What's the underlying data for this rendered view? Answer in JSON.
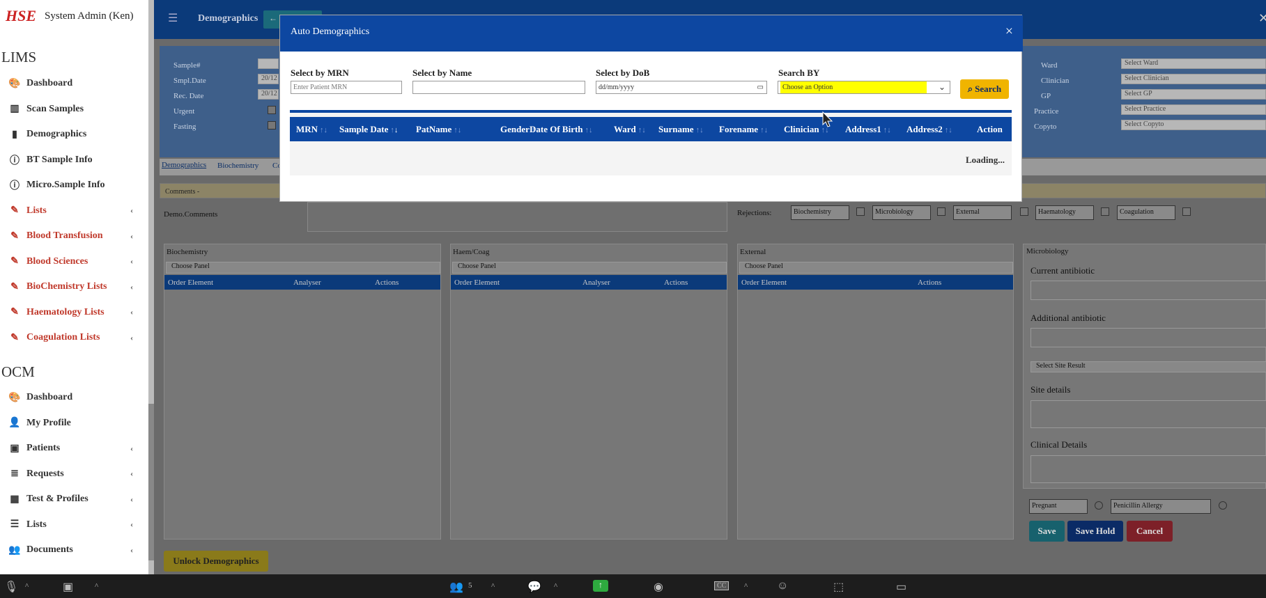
{
  "user": {
    "logo": "HSE",
    "name": "System Admin (Ken)"
  },
  "sidebar": {
    "lims_title": "LIMS",
    "lims_items": [
      {
        "label": "Dashboard",
        "icon": "palette-icon"
      },
      {
        "label": "Scan Samples",
        "icon": "barcode-icon"
      },
      {
        "label": "Demographics",
        "icon": "file-icon"
      },
      {
        "label": "BT Sample Info",
        "icon": "info-icon"
      },
      {
        "label": "Micro.Sample Info",
        "icon": "info-icon"
      },
      {
        "label": "Lists",
        "icon": "pen-icon"
      },
      {
        "label": "Blood Transfusion",
        "icon": "pen-icon"
      },
      {
        "label": "Blood Sciences",
        "icon": "pen-icon"
      },
      {
        "label": "BioChemistry Lists",
        "icon": "pen-icon"
      },
      {
        "label": "Haematology Lists",
        "icon": "pen-icon"
      },
      {
        "label": "Coagulation Lists",
        "icon": "pen-icon"
      }
    ],
    "ocm_title": "OCM",
    "ocm_items": [
      {
        "label": "Dashboard",
        "icon": "palette-icon"
      },
      {
        "label": "My Profile",
        "icon": "user-icon"
      },
      {
        "label": "Patients",
        "icon": "patients-icon"
      },
      {
        "label": "Requests",
        "icon": "stack-icon"
      },
      {
        "label": "Test & Profiles",
        "icon": "grid-icon"
      },
      {
        "label": "Lists",
        "icon": "list-icon"
      },
      {
        "label": "Documents",
        "icon": "users-icon"
      }
    ]
  },
  "topbar": {
    "title": "Demographics",
    "menu_icon": "hamburger-icon"
  },
  "form": {
    "left_labels": [
      "Sample#",
      "Smpl.Date",
      "Rec. Date",
      "Urgent",
      "Fasting"
    ],
    "date1": "20/12",
    "date2": "20/12",
    "right_labels": [
      "Ward",
      "Clinician",
      "GP",
      "Practice",
      "Copyto"
    ],
    "right_placeholders": [
      "Select Ward",
      "Select Clinician",
      "Select GP",
      "Select Practice",
      "Select Copyto"
    ]
  },
  "tabs": {
    "items": [
      "Demographics",
      "Biochemistry",
      "Co"
    ]
  },
  "comments": {
    "bar": "Comments -",
    "demo_label": "Demo.Comments"
  },
  "rejections": {
    "label": "Rejections:",
    "items": [
      "Biochemistry",
      "Microbiology",
      "External",
      "Haematology",
      "Coagulation"
    ]
  },
  "panels": [
    {
      "title": "Biochemistry",
      "select": "Choose Panel",
      "cols": [
        "Order Element",
        "Analyser",
        "Actions"
      ]
    },
    {
      "title": "Haem/Coag",
      "select": "Choose Panel",
      "cols": [
        "Order Element",
        "Analyser",
        "Actions"
      ]
    },
    {
      "title": "External",
      "select": "Choose Panel",
      "cols": [
        "Order Element",
        "Actions"
      ]
    }
  ],
  "micro": {
    "title": "Microbiology",
    "current": "Current antibiotic",
    "additional": "Additional antibiotic",
    "site_select": "Select Site Result",
    "site_details": "Site details",
    "clinical": "Clinical Details",
    "pregnant": "Pregnant",
    "penicillin": "Penicillin Allergy"
  },
  "buttons": {
    "save": "Save",
    "save_hold": "Save Hold",
    "cancel": "Cancel",
    "unlock": "Unlock Demographics"
  },
  "modal": {
    "title": "Auto Demographics",
    "close": "×",
    "mrn_label": "Select by MRN",
    "mrn_placeholder": "Enter Patient MRN",
    "name_label": "Select by Name",
    "name_value": "",
    "dob_label": "Select by DoB",
    "dob_placeholder": "dd/mm/yyyy",
    "searchby_label": "Search BY",
    "searchby_value": "Choose an Option",
    "search_button": "Search",
    "columns": [
      "MRN",
      "Sample Date",
      "PatName",
      "Gender",
      "Date Of Birth",
      "Ward",
      "Surname",
      "Forename",
      "Clinician",
      "Address1",
      "Address2",
      "Action"
    ],
    "loading": "Loading..."
  },
  "taskbar": {
    "participants": "5",
    "cc": "CC"
  },
  "colors": {
    "modal_header": "#0d47a1",
    "highlight": "#ffff00",
    "search_button": "#f0b400",
    "save": "#17a2b8",
    "save_hold": "#0d47a1",
    "cancel": "#dc3545"
  }
}
